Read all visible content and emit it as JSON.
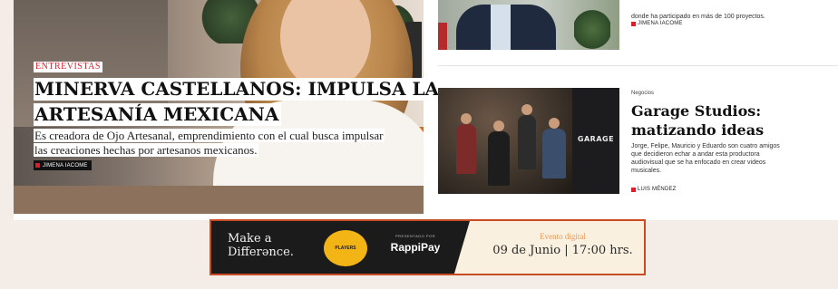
{
  "feature": {
    "tag": "ENTREVISTAS",
    "headline_line1": "MINERVA CASTELLANOS: IMPULSA LA",
    "headline_line2": "ARTESANÍA MEXICANA",
    "dek_line1": "Es creadora de Ojo Artesanal, emprendimiento con el cual busca impulsar",
    "dek_line2": "las creaciones hechas por artesanos mexicanos.",
    "author": "JIMENA IACOME"
  },
  "top_article": {
    "body": "donde ha participado en más de 100 proyectos.",
    "author": "JIMENA IACOME"
  },
  "garage_article": {
    "section": "Negocios",
    "title": "Garage Studios: matizando ideas",
    "body_lines": [
      "Jorge, Felipe, Mauricio y Eduardo son cuatro amigos",
      "que decidieron echar a andar esta productora",
      "audiovisual que se ha enfocado en crear videos",
      "musicales."
    ],
    "thumb_logo": "GARAGE",
    "author": "LUIS MÉNDEZ"
  },
  "ad": {
    "tagline_line1": "Make a",
    "tagline_line2": "Differənce.",
    "drink_label": "PLAYERS",
    "presented_by": "PRESENTADO POR",
    "sponsor": "RappiPay",
    "event_type": "Evento digital",
    "date_time": "09 de Junio | 17:00 hrs."
  },
  "colors": {
    "accent_red": "#d91f2b",
    "ad_border": "#c84b24",
    "ad_gold": "#f3b515"
  }
}
